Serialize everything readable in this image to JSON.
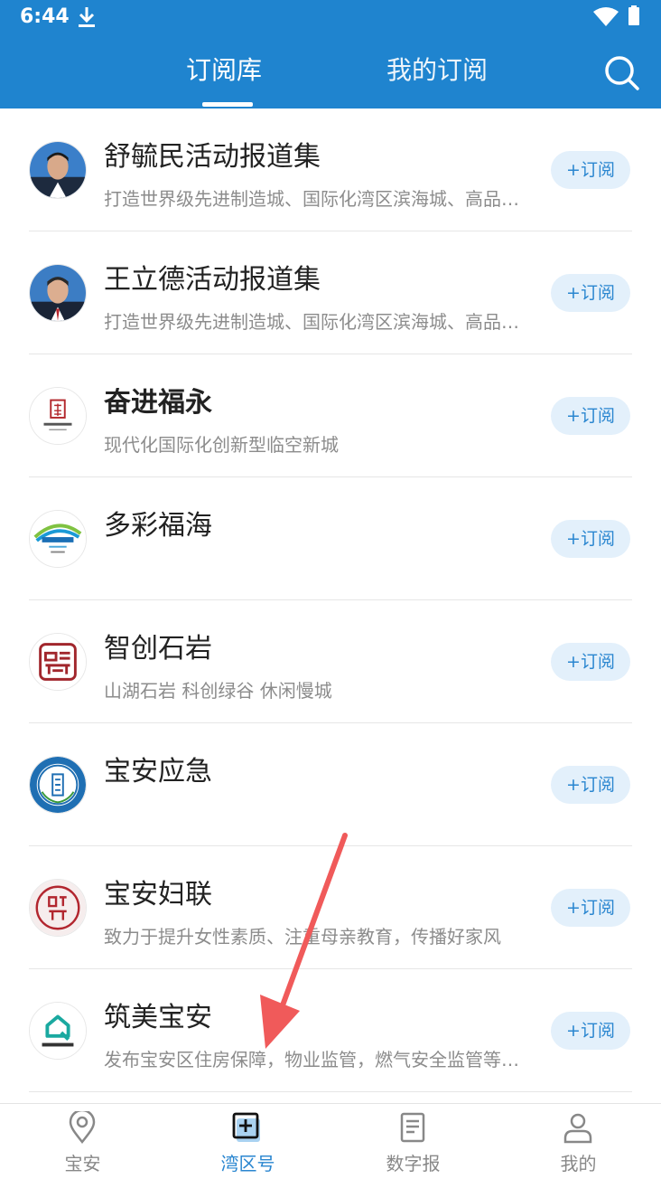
{
  "status": {
    "time": "6:44"
  },
  "header": {
    "tabs": [
      {
        "label": "订阅库",
        "active": true
      },
      {
        "label": "我的订阅",
        "active": false
      }
    ],
    "accent": "#1f84cf"
  },
  "subscribe_label": "+订阅",
  "items": [
    {
      "name": "舒毓民活动报道集",
      "desc": "打造世界级先进制造城、国际化湾区滨海城、高品质宜居宜业城",
      "avatar": "portrait-1"
    },
    {
      "name": "王立德活动报道集",
      "desc": "打造世界级先进制造城、国际化湾区滨海城、高品质宜居宜业城",
      "avatar": "portrait-2"
    },
    {
      "name": "奋进福永",
      "desc": "现代化国际化创新型临空新城",
      "avatar": "fuyong-logo"
    },
    {
      "name": "多彩福海",
      "desc": "",
      "avatar": "fuhai-logo"
    },
    {
      "name": "智创石岩",
      "desc": "山湖石岩  科创绿谷  休闲慢城",
      "avatar": "shiyan-logo"
    },
    {
      "name": "宝安应急",
      "desc": "",
      "avatar": "emergency-logo"
    },
    {
      "name": "宝安妇联",
      "desc": "致力于提升女性素质、注重母亲教育，传播好家风",
      "avatar": "women-federation-logo"
    },
    {
      "name": "筑美宝安",
      "desc": "发布宝安区住房保障，物业监管，燃气安全监管等信息",
      "avatar": "zhumei-logo"
    }
  ],
  "bottom_nav": [
    {
      "label": "宝安",
      "icon": "location-pin-icon",
      "active": false
    },
    {
      "label": "湾区号",
      "icon": "plus-box-icon",
      "active": true
    },
    {
      "label": "数字报",
      "icon": "newspaper-icon",
      "active": false
    },
    {
      "label": "我的",
      "icon": "person-icon",
      "active": false
    }
  ]
}
